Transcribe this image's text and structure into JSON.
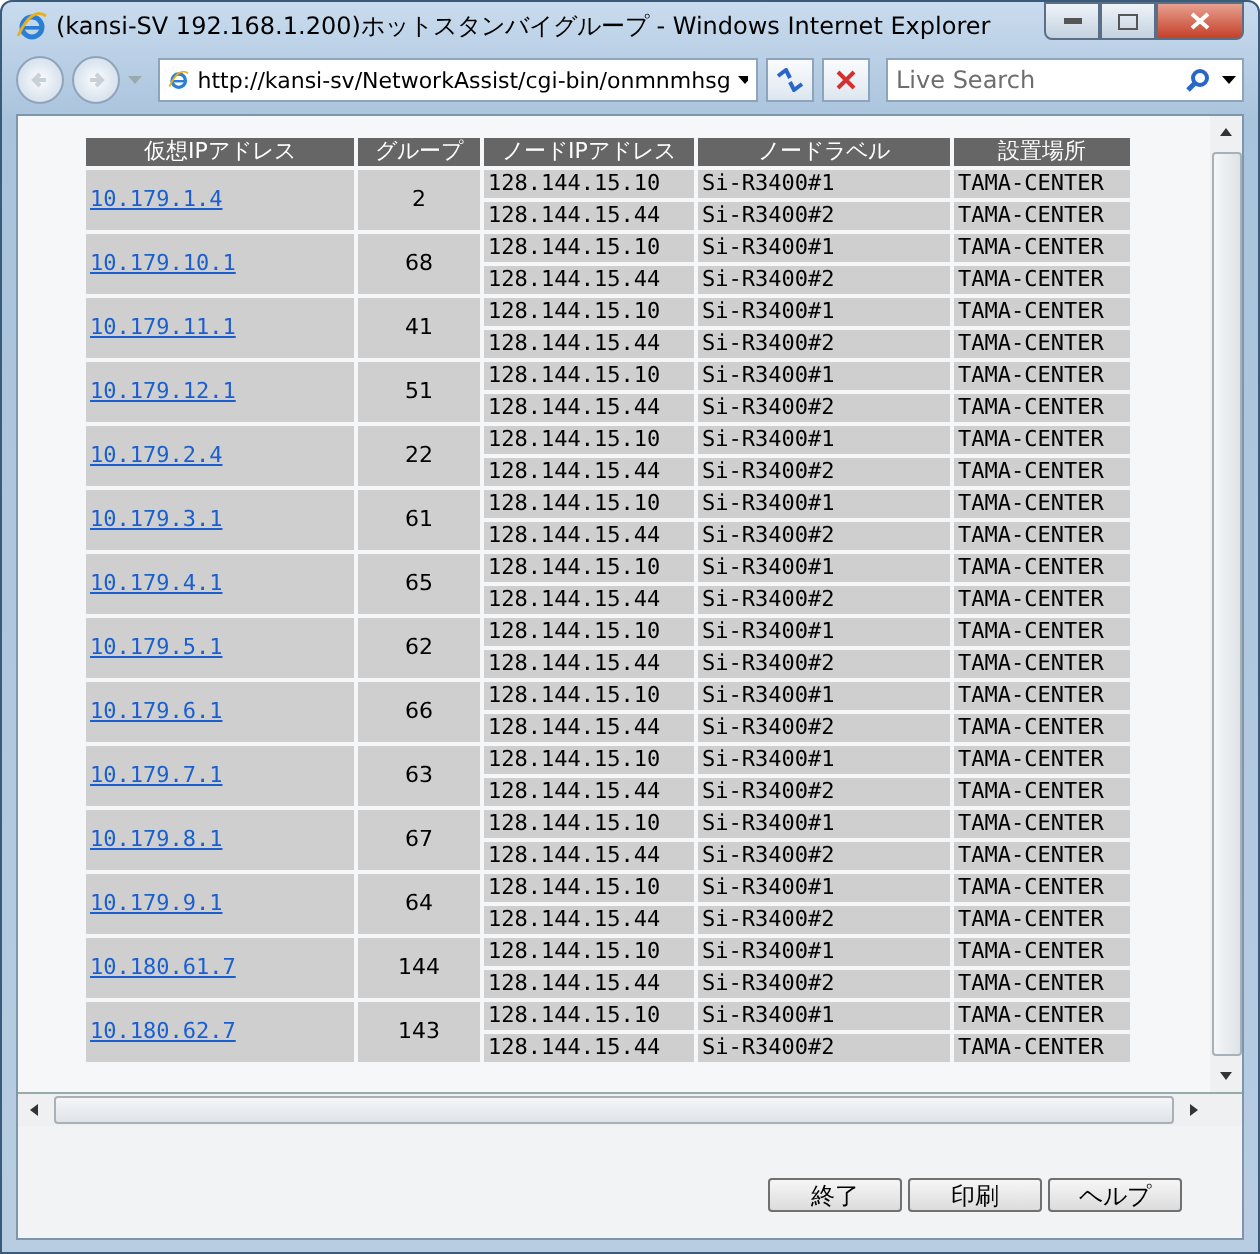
{
  "window": {
    "title": "(kansi-SV 192.168.1.200)ホットスタンバイグループ - Windows Internet Explorer"
  },
  "address_bar": {
    "value": "http://kansi-sv/NetworkAssist/cgi-bin/onmnmhsg"
  },
  "search": {
    "placeholder": "Live Search"
  },
  "table": {
    "columns": [
      "仮想IPアドレス",
      "グループ",
      "ノードIPアドレス",
      "ノードラベル",
      "設置場所"
    ],
    "rows": [
      {
        "virtual_ip": "10.179.1.4",
        "group": "2",
        "nodes": [
          {
            "ip": "128.144.15.10",
            "label": "Si-R3400#1",
            "location": "TAMA-CENTER"
          },
          {
            "ip": "128.144.15.44",
            "label": "Si-R3400#2",
            "location": "TAMA-CENTER"
          }
        ]
      },
      {
        "virtual_ip": "10.179.10.1",
        "group": "68",
        "nodes": [
          {
            "ip": "128.144.15.10",
            "label": "Si-R3400#1",
            "location": "TAMA-CENTER"
          },
          {
            "ip": "128.144.15.44",
            "label": "Si-R3400#2",
            "location": "TAMA-CENTER"
          }
        ]
      },
      {
        "virtual_ip": "10.179.11.1",
        "group": "41",
        "nodes": [
          {
            "ip": "128.144.15.10",
            "label": "Si-R3400#1",
            "location": "TAMA-CENTER"
          },
          {
            "ip": "128.144.15.44",
            "label": "Si-R3400#2",
            "location": "TAMA-CENTER"
          }
        ]
      },
      {
        "virtual_ip": "10.179.12.1",
        "group": "51",
        "nodes": [
          {
            "ip": "128.144.15.10",
            "label": "Si-R3400#1",
            "location": "TAMA-CENTER"
          },
          {
            "ip": "128.144.15.44",
            "label": "Si-R3400#2",
            "location": "TAMA-CENTER"
          }
        ]
      },
      {
        "virtual_ip": "10.179.2.4",
        "group": "22",
        "nodes": [
          {
            "ip": "128.144.15.10",
            "label": "Si-R3400#1",
            "location": "TAMA-CENTER"
          },
          {
            "ip": "128.144.15.44",
            "label": "Si-R3400#2",
            "location": "TAMA-CENTER"
          }
        ]
      },
      {
        "virtual_ip": "10.179.3.1",
        "group": "61",
        "nodes": [
          {
            "ip": "128.144.15.10",
            "label": "Si-R3400#1",
            "location": "TAMA-CENTER"
          },
          {
            "ip": "128.144.15.44",
            "label": "Si-R3400#2",
            "location": "TAMA-CENTER"
          }
        ]
      },
      {
        "virtual_ip": "10.179.4.1",
        "group": "65",
        "nodes": [
          {
            "ip": "128.144.15.10",
            "label": "Si-R3400#1",
            "location": "TAMA-CENTER"
          },
          {
            "ip": "128.144.15.44",
            "label": "Si-R3400#2",
            "location": "TAMA-CENTER"
          }
        ]
      },
      {
        "virtual_ip": "10.179.5.1",
        "group": "62",
        "nodes": [
          {
            "ip": "128.144.15.10",
            "label": "Si-R3400#1",
            "location": "TAMA-CENTER"
          },
          {
            "ip": "128.144.15.44",
            "label": "Si-R3400#2",
            "location": "TAMA-CENTER"
          }
        ]
      },
      {
        "virtual_ip": "10.179.6.1",
        "group": "66",
        "nodes": [
          {
            "ip": "128.144.15.10",
            "label": "Si-R3400#1",
            "location": "TAMA-CENTER"
          },
          {
            "ip": "128.144.15.44",
            "label": "Si-R3400#2",
            "location": "TAMA-CENTER"
          }
        ]
      },
      {
        "virtual_ip": "10.179.7.1",
        "group": "63",
        "nodes": [
          {
            "ip": "128.144.15.10",
            "label": "Si-R3400#1",
            "location": "TAMA-CENTER"
          },
          {
            "ip": "128.144.15.44",
            "label": "Si-R3400#2",
            "location": "TAMA-CENTER"
          }
        ]
      },
      {
        "virtual_ip": "10.179.8.1",
        "group": "67",
        "nodes": [
          {
            "ip": "128.144.15.10",
            "label": "Si-R3400#1",
            "location": "TAMA-CENTER"
          },
          {
            "ip": "128.144.15.44",
            "label": "Si-R3400#2",
            "location": "TAMA-CENTER"
          }
        ]
      },
      {
        "virtual_ip": "10.179.9.1",
        "group": "64",
        "nodes": [
          {
            "ip": "128.144.15.10",
            "label": "Si-R3400#1",
            "location": "TAMA-CENTER"
          },
          {
            "ip": "128.144.15.44",
            "label": "Si-R3400#2",
            "location": "TAMA-CENTER"
          }
        ]
      },
      {
        "virtual_ip": "10.180.61.7",
        "group": "144",
        "nodes": [
          {
            "ip": "128.144.15.10",
            "label": "Si-R3400#1",
            "location": "TAMA-CENTER"
          },
          {
            "ip": "128.144.15.44",
            "label": "Si-R3400#2",
            "location": "TAMA-CENTER"
          }
        ]
      },
      {
        "virtual_ip": "10.180.62.7",
        "group": "143",
        "nodes": [
          {
            "ip": "128.144.15.10",
            "label": "Si-R3400#1",
            "location": "TAMA-CENTER"
          },
          {
            "ip": "128.144.15.44",
            "label": "Si-R3400#2",
            "location": "TAMA-CENTER"
          }
        ]
      }
    ]
  },
  "buttons": [
    "終了",
    "印刷",
    "ヘルプ"
  ]
}
